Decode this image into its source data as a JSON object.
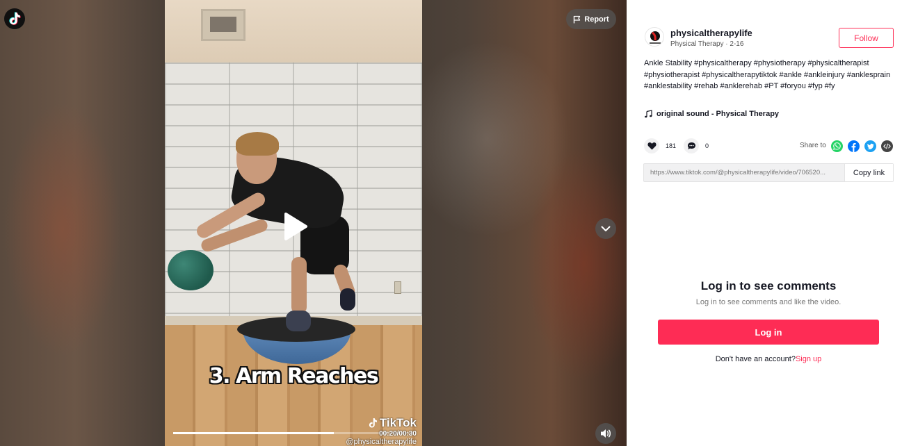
{
  "video": {
    "report_label": "Report",
    "caption_overlay": "3. Arm Reaches",
    "watermark_brand": "TikTok",
    "time_display": "00:20/00:30",
    "watermark_user": "@physicaltherapylife",
    "progress": 0.6667
  },
  "author": {
    "name": "physicaltherapylife",
    "subtitle": "Physical Therapy · 2-16",
    "follow_label": "Follow"
  },
  "description": {
    "text": "Ankle Stability",
    "hashtags": [
      "#physicaltherapy",
      "#physiotherapy",
      "#physicaltherapist",
      "#physiotherapist",
      "#physicaltherapytiktok",
      "#ankle",
      "#ankleinjury",
      "#anklesprain",
      "#anklestability",
      "#rehab",
      "#anklerehab",
      "#PT",
      "#foryou",
      "#fyp",
      "#fy"
    ]
  },
  "music": {
    "label": "original sound - Physical Therapy"
  },
  "stats": {
    "likes": "181",
    "comments": "0"
  },
  "share": {
    "label": "Share to",
    "targets": [
      "whatsapp-icon",
      "facebook-icon",
      "twitter-icon",
      "embed-icon"
    ],
    "colors": {
      "whatsapp": "#25d366",
      "facebook": "#0075fa",
      "twitter": "#1da1f2",
      "embed": "#444"
    }
  },
  "link": {
    "url": "https://www.tiktok.com/@physicaltherapylife/video/706520...",
    "copy_label": "Copy link"
  },
  "login": {
    "title": "Log in to see comments",
    "subtitle": "Log in to see comments and like the video.",
    "button_label": "Log in",
    "signup_prompt": "Don't have an account?",
    "signup_link": "Sign up"
  },
  "colors": {
    "accent": "#fe2c55",
    "text": "#161823"
  }
}
